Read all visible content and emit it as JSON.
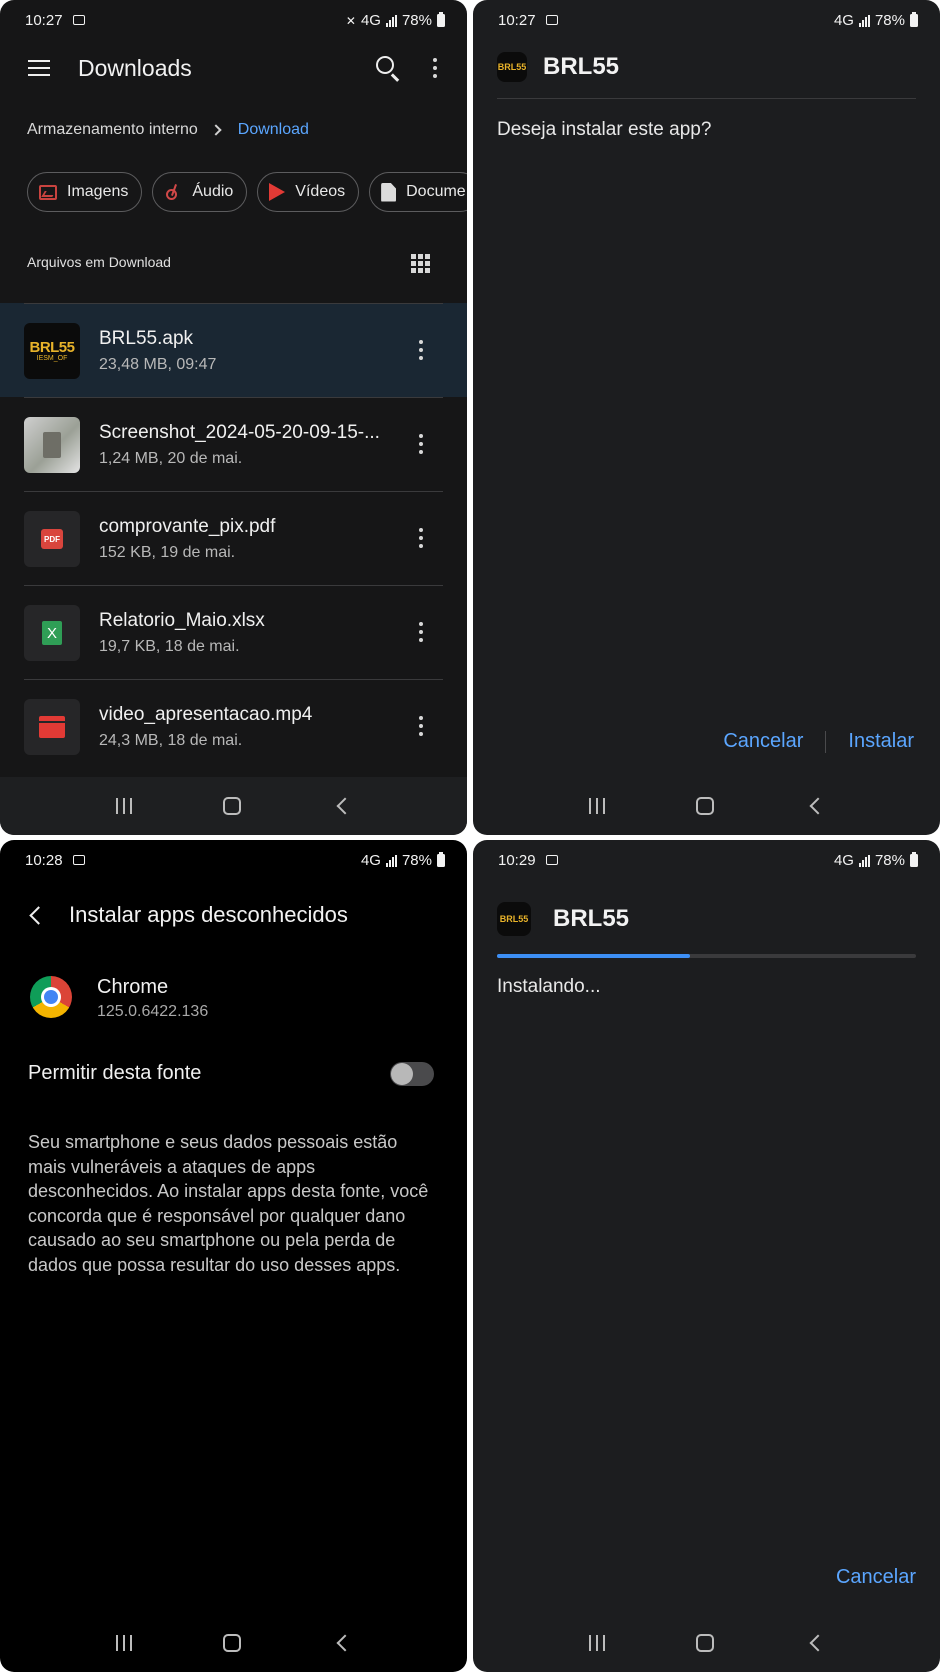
{
  "panel1": {
    "status": {
      "time": "10:27",
      "network": "4G",
      "battery": "78%"
    },
    "title": "Downloads",
    "breadcrumb": {
      "root": "Armazenamento interno",
      "current": "Download"
    },
    "chips": [
      "Imagens",
      "Áudio",
      "Vídeos",
      "Docume"
    ],
    "section_title": "Arquivos em Download",
    "files": [
      {
        "name": "BRL55.apk",
        "meta": "23,48 MB, 09:47",
        "logo_text": "BRL55",
        "logo_sub": "IESM_OF"
      },
      {
        "name": "Screenshot_2024-05-20-09-15-...",
        "meta": "1,24 MB, 20 de mai."
      },
      {
        "name": "comprovante_pix.pdf",
        "meta": "152 KB, 19 de mai.",
        "badge": "PDF"
      },
      {
        "name": "Relatorio_Maio.xlsx",
        "meta": "19,7 KB, 18 de mai.",
        "badge": "X"
      },
      {
        "name": "video_apresentacao.mp4",
        "meta": "24,3 MB, 18 de mai."
      }
    ]
  },
  "panel2": {
    "status": {
      "time": "10:27",
      "network": "4G",
      "battery": "78%"
    },
    "app_name": "BRL55",
    "logo_text": "BRL55",
    "question": "Deseja instalar este app?",
    "cancel_label": "Cancelar",
    "install_label": "Instalar"
  },
  "panel3": {
    "status": {
      "time": "10:28",
      "network": "4G",
      "battery": "78%"
    },
    "title": "Instalar apps desconhecidos",
    "app_name": "Chrome",
    "app_version": "125.0.6422.136",
    "permit_label": "Permitir desta fonte",
    "permit_enabled": false,
    "warning": "Seu smartphone e seus dados pessoais estão mais vulneráveis a ataques de apps desconhecidos. Ao instalar apps desta fonte, você concorda que é responsável por qualquer dano causado ao seu smartphone ou pela perda de dados que possa resultar do uso desses apps."
  },
  "panel4": {
    "status": {
      "time": "10:29",
      "network": "4G",
      "battery": "78%"
    },
    "app_name": "BRL55",
    "logo_text": "BRL55",
    "progress_fraction": 0.46,
    "installing_label": "Instalando...",
    "cancel_label": "Cancelar"
  },
  "colors": {
    "accent": "#5ba6ff",
    "progress": "#3d8ff5",
    "selected_row": "#1a2733"
  }
}
